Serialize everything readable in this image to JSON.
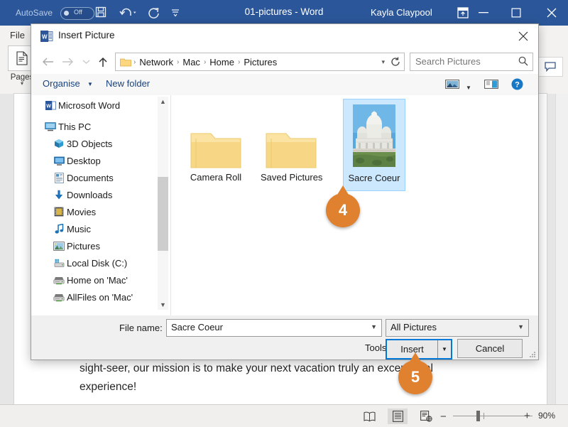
{
  "word": {
    "autosave_label": "AutoSave",
    "autosave_state": "Off",
    "title": "01-pictures - Word",
    "user": "Kayla Claypool",
    "file_tab": "File",
    "ribbon_group_label": "Pages",
    "document_text": "sight-seer, our mission is to make your next vacation truly an exceptional experience!",
    "status": {
      "zoom": "90%",
      "zoom_minus": "−",
      "zoom_plus": "+"
    }
  },
  "dialog": {
    "title": "Insert Picture",
    "breadcrumbs": [
      "Network",
      "Mac",
      "Home",
      "Pictures"
    ],
    "breadcrumb_sep": "›",
    "search_placeholder": "Search Pictures",
    "commands": {
      "organise": "Organise",
      "new_folder": "New folder"
    },
    "nav_items": [
      {
        "label": "Microsoft Word",
        "icon": "word-icon",
        "indent": false
      },
      {
        "label": "This PC",
        "icon": "this-pc-icon",
        "indent": false
      },
      {
        "label": "3D Objects",
        "icon": "3d-objects-icon",
        "indent": true
      },
      {
        "label": "Desktop",
        "icon": "desktop-icon",
        "indent": true
      },
      {
        "label": "Documents",
        "icon": "documents-icon",
        "indent": true
      },
      {
        "label": "Downloads",
        "icon": "downloads-icon",
        "indent": true
      },
      {
        "label": "Movies",
        "icon": "movies-icon",
        "indent": true
      },
      {
        "label": "Music",
        "icon": "music-icon",
        "indent": true
      },
      {
        "label": "Pictures",
        "icon": "pictures-icon",
        "indent": true
      },
      {
        "label": "Local Disk (C:)",
        "icon": "disk-icon",
        "indent": true
      },
      {
        "label": "Home on 'Mac'",
        "icon": "network-drive-icon",
        "indent": true
      },
      {
        "label": "AllFiles on 'Mac'",
        "icon": "network-drive-icon",
        "indent": true
      }
    ],
    "files": [
      {
        "name": "Camera Roll",
        "type": "folder",
        "selected": false
      },
      {
        "name": "Saved Pictures",
        "type": "folder",
        "selected": false
      },
      {
        "name": "Sacre Coeur",
        "type": "image",
        "selected": true
      }
    ],
    "file_name_label": "File name:",
    "file_name_value": "Sacre Coeur",
    "file_type_value": "All Pictures",
    "tools_label": "Tools",
    "insert_label": "Insert",
    "cancel_label": "Cancel"
  },
  "callouts": [
    {
      "number": "4"
    },
    {
      "number": "5"
    }
  ],
  "colors": {
    "word_blue": "#2b579a",
    "accent_orange": "#e0812f",
    "selection_blue": "#cce8ff",
    "focus_blue": "#0078d7"
  }
}
